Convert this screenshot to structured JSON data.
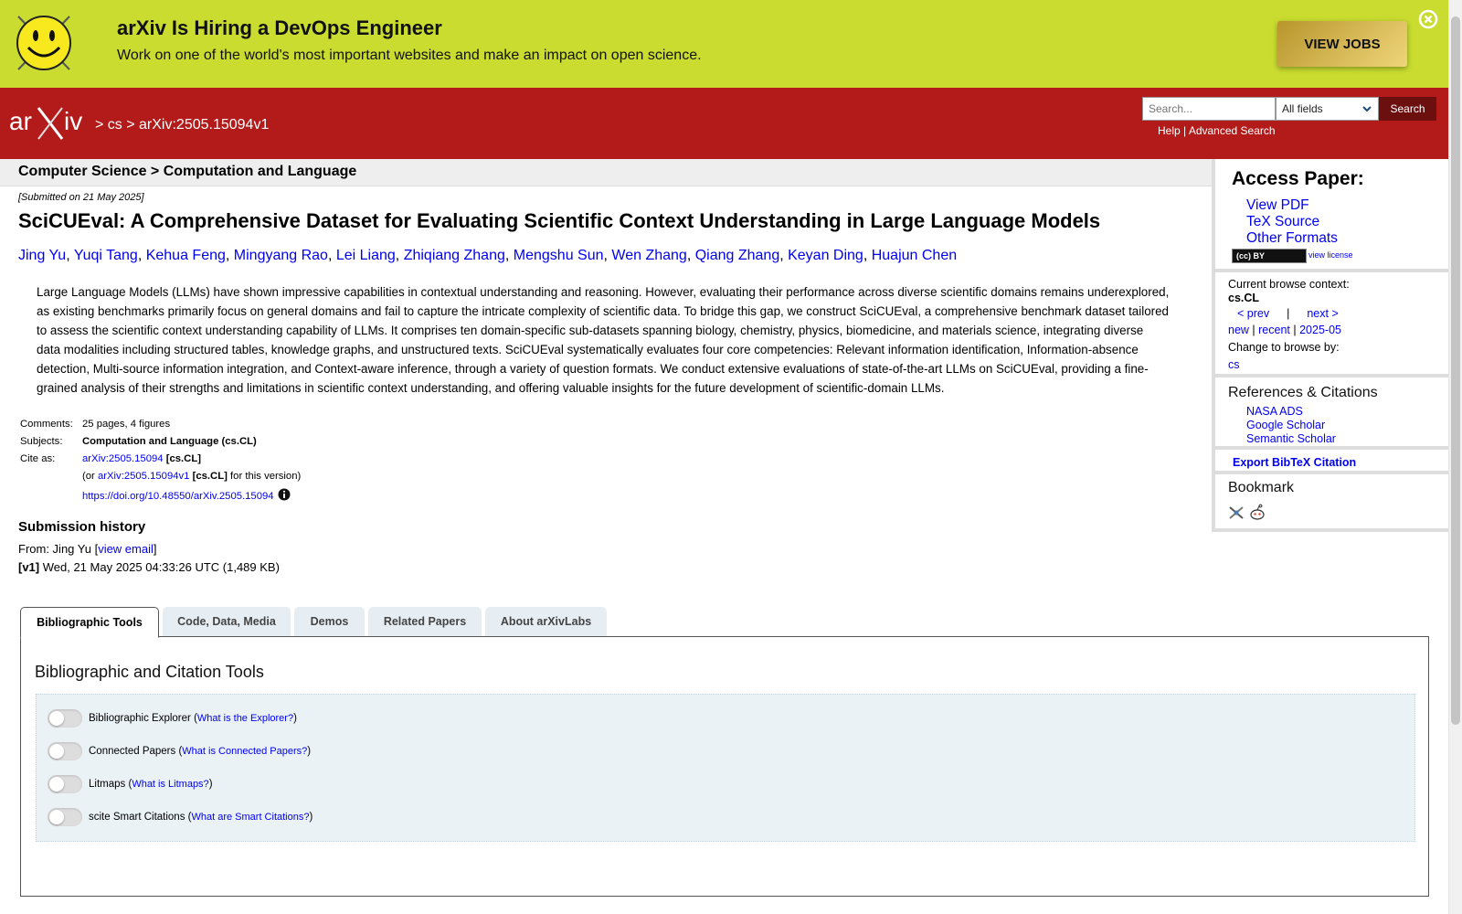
{
  "banner": {
    "title": "arXiv Is Hiring a DevOps Engineer",
    "subtitle": "Work on one of the world's most important websites and make an impact on open science.",
    "cta": "VIEW JOBS"
  },
  "header": {
    "crumbs": "> cs > arXiv:2505.15094v1",
    "search_placeholder": "Search...",
    "search_field": "All fields",
    "search_button": "Search",
    "help": "Help",
    "separator": " | ",
    "advanced": "Advanced Search"
  },
  "subject_bar": "Computer Science > Computation and Language",
  "paper": {
    "submitted": "[Submitted on 21 May 2025]",
    "title": "SciCUEval: A Comprehensive Dataset for Evaluating Scientific Context Understanding in Large Language Models",
    "authors": [
      "Jing Yu",
      "Yuqi Tang",
      "Kehua Feng",
      "Mingyang Rao",
      "Lei Liang",
      "Zhiqiang Zhang",
      "Mengshu Sun",
      "Wen Zhang",
      "Qiang Zhang",
      "Keyan Ding",
      "Huajun Chen"
    ],
    "abstract": "Large Language Models (LLMs) have shown impressive capabilities in contextual understanding and reasoning. However, evaluating their performance across diverse scientific domains remains underexplored, as existing benchmarks primarily focus on general domains and fail to capture the intricate complexity of scientific data. To bridge this gap, we construct SciCUEval, a comprehensive benchmark dataset tailored to assess the scientific context understanding capability of LLMs. It comprises ten domain-specific sub-datasets spanning biology, chemistry, physics, biomedicine, and materials science, integrating diverse data modalities including structured tables, knowledge graphs, and unstructured texts. SciCUEval systematically evaluates four core competencies: Relevant information identification, Information-absence detection, Multi-source information integration, and Context-aware inference, through a variety of question formats. We conduct extensive evaluations of state-of-the-art LLMs on SciCUEval, providing a fine-grained analysis of their strengths and limitations in scientific context understanding, and offering valuable insights for the future development of scientific-domain LLMs."
  },
  "meta": {
    "comments_label": "Comments:",
    "comments": "25 pages, 4 figures",
    "subjects_label": "Subjects:",
    "subjects": "Computation and Language (cs.CL)",
    "cite_label": "Cite as:",
    "cite_id": "arXiv:2505.15094",
    "cite_cat": "[cs.CL]",
    "or_prefix": "(or ",
    "cite_version": "arXiv:2505.15094v1",
    "version_cat": "[cs.CL]",
    "version_suffix": " for this version)",
    "doi": "https://doi.org/10.48550/arXiv.2505.15094"
  },
  "history": {
    "title": "Submission history",
    "from_prefix": "From: Jing Yu [",
    "view_email": "view email",
    "from_suffix": "]",
    "v1_label": "[v1]",
    "v1_text": " Wed, 21 May 2025 04:33:26 UTC (1,489 KB)"
  },
  "tabs": [
    "Bibliographic Tools",
    "Code, Data, Media",
    "Demos",
    "Related Papers",
    "About arXivLabs"
  ],
  "tools_panel": {
    "title": "Bibliographic and Citation Tools",
    "tools": [
      {
        "name": "Bibliographic Explorer",
        "link": "What is the Explorer?"
      },
      {
        "name": "Connected Papers",
        "link": "What is Connected Papers?"
      },
      {
        "name": "Litmaps",
        "link": "What is Litmaps?"
      },
      {
        "name": "scite Smart Citations",
        "link": "What are Smart Citations?"
      }
    ]
  },
  "sidebar": {
    "access_title": "Access Paper:",
    "access_links": [
      "View PDF",
      "TeX Source",
      "Other Formats"
    ],
    "license_badge": "(cc) BY",
    "view_license": "view license",
    "context_label": "Current browse context:",
    "context": "cs.CL",
    "prev": "< prev",
    "pipe": "|",
    "next": "next >",
    "new": "new",
    "recent": "recent",
    "month": "2025-05",
    "change_label": "Change to browse by:",
    "browse_cs": "cs",
    "refs_title": "References & Citations",
    "refs": [
      "NASA ADS",
      "Google Scholar",
      "Semantic Scholar"
    ],
    "export": "Export BibTeX Citation",
    "bookmark_title": "Bookmark"
  },
  "icons": {
    "banner": "smiley-face-icon",
    "close": "close-icon",
    "info": "info-icon",
    "bookmarks": [
      "bibsonomy-icon",
      "reddit-icon"
    ]
  },
  "colors": {
    "banner_bg": "#c9dc2f",
    "header_bg": "#b31b1b",
    "search_btn": "#6b0f0f",
    "link": "#0000ee"
  }
}
